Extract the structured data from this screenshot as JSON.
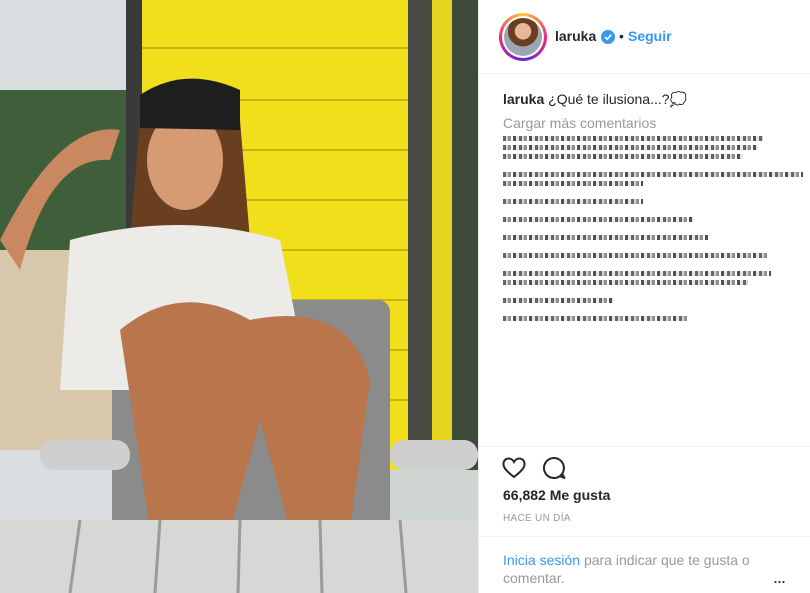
{
  "post": {
    "username": "laruka",
    "dot": "•",
    "follow_label": "Seguir",
    "caption_user": "laruka",
    "caption_text": "¿Qué te ilusiona...?💭",
    "load_more": "Cargar más comentarios",
    "likes": "66,882 Me gusta",
    "time_ago": "HACE UN DÍA",
    "login_link": "Inicia sesión",
    "login_text": "para indicar que te gusta o comentar.",
    "more_label": "..."
  },
  "icons": {
    "verified": "verified-badge-icon",
    "heart": "heart-icon",
    "comment": "comment-icon",
    "more": "more-options-icon"
  },
  "colors": {
    "link": "#3897f0",
    "wall": "#f5e21f",
    "muted": "#999999"
  }
}
